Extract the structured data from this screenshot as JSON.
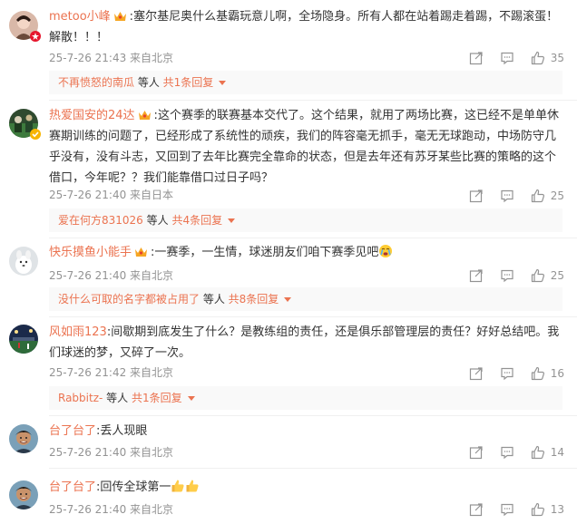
{
  "comments": [
    {
      "username": "metoo小峰",
      "separator": ":",
      "text": "塞尔基尼奥什么基霸玩意儿啊，全场隐身。所有人都在站着踢走着踢，不踢滚蛋！解散！！！",
      "meta": "25-7-26 21:43 来自北京",
      "likes": "35",
      "reply": {
        "name": "不再愤怒的南瓜",
        "mid": " 等人 ",
        "count": "共1条回复"
      }
    },
    {
      "username": "热爱国安的24达",
      "separator": ":",
      "text": "这个赛季的联赛基本交代了。这个结果，就用了两场比赛，这已经不是单单休赛期训练的问题了，已经形成了系统性的顽疾，我们的阵容毫无抓手，毫无无球跑动，中场防守几乎没有，没有斗志，又回到了去年比赛完全靠命的状态，但是去年还有苏牙某些比赛的策略的这个借口，今年呢？？我们能靠借口过日子吗？",
      "meta": "25-7-26 21:40 来自日本",
      "likes": "25",
      "reply": {
        "name": "爱在何方831026",
        "mid": " 等人 ",
        "count": "共4条回复"
      }
    },
    {
      "username": "快乐摸鱼小能手",
      "separator": ":",
      "text": "一赛季，一生情，球迷朋友们咱下赛季见吧",
      "meta": "25-7-26 21:40 来自北京",
      "likes": "25",
      "reply": {
        "name": "没什么可取的名字都被占用了",
        "mid": " 等人 ",
        "count": "共8条回复"
      }
    },
    {
      "username": "风如雨123",
      "separator": ":",
      "text": "间歇期到底发生了什么？是教练组的责任，还是俱乐部管理层的责任？好好总结吧。我们球迷的梦，又碎了一次。",
      "meta": "25-7-26 21:42 来自北京",
      "likes": "16",
      "reply": {
        "name": "Rabbitz-",
        "mid": " 等人 ",
        "count": "共1条回复"
      }
    },
    {
      "username": "台了台了",
      "separator": ":",
      "text": "丢人现眼",
      "meta": "25-7-26 21:40 来自北京",
      "likes": "14"
    },
    {
      "username": "台了台了",
      "separator": ":",
      "text": "回传全球第一",
      "meta": "25-7-26 21:40 来自北京",
      "likes": "13"
    }
  ],
  "icons": {
    "share": "share-icon",
    "comment": "comment-icon",
    "like": "thumbs-up-icon",
    "badge": "crown-badge-icon",
    "reply_caret": "caret-down-icon"
  },
  "colors": {
    "accent": "#eb7350",
    "muted": "#939393",
    "reply_bg": "#f9f9f9"
  }
}
